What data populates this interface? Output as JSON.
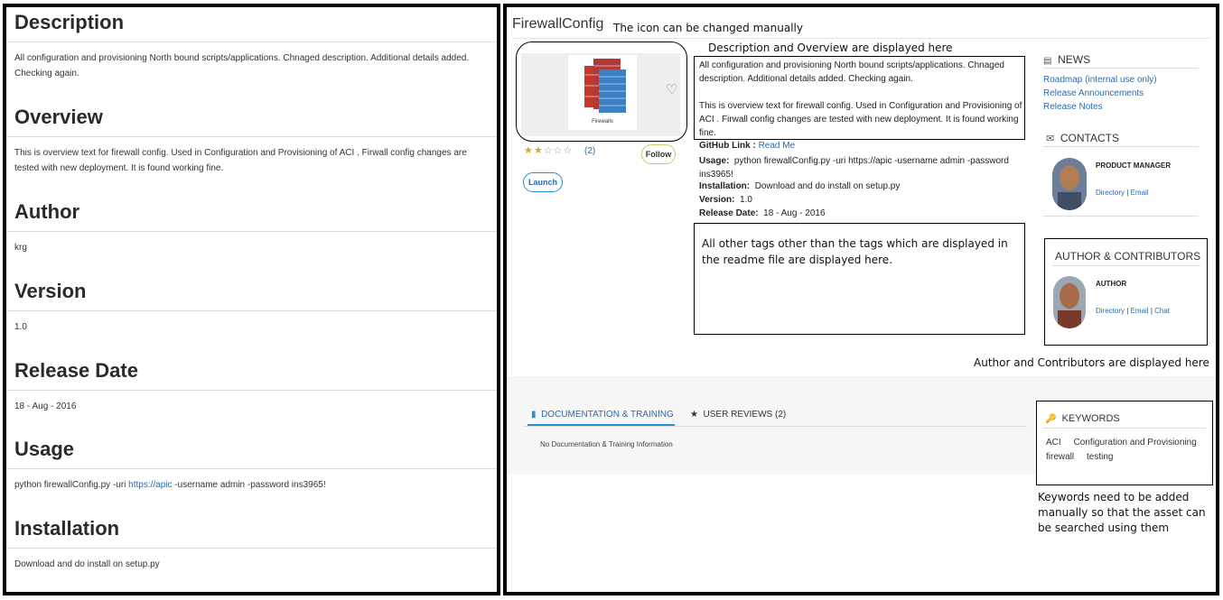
{
  "readme": {
    "sections": [
      {
        "heading": "Description",
        "body": "All configuration and provisioning North bound scripts/applications. Chnaged description. Additional details added. Checking again."
      },
      {
        "heading": "Overview",
        "body": "This is overview text for firewall config. Used in Configuration and Provisioning of ACI . Firwall config changes are tested with new deployment. It is found working fine."
      },
      {
        "heading": "Author",
        "body": "krg"
      },
      {
        "heading": "Version",
        "body": "1.0"
      },
      {
        "heading": "Release Date",
        "body": "18 - Aug - 2016"
      },
      {
        "heading": "Usage",
        "body_before": "python firewallConfig.py -uri ",
        "body_link": "https://apic",
        "body_after": " -username admin -password ins3965!"
      },
      {
        "heading": "Installation",
        "body": "Download and do install on setup.py"
      }
    ]
  },
  "asset": {
    "title": "FirewallConfig",
    "icon_note": "The icon can be changed manually",
    "icon": {
      "name": "firewall-icon",
      "caption": "Firewalls",
      "colors": {
        "brick_red": "#c0392b",
        "brick_blue": "#3b7fc4"
      }
    },
    "rating": {
      "value": 2,
      "max": 5,
      "count": "(2)"
    },
    "follow_label": "Follow",
    "launch_label": "Launch",
    "desc_note": "Description and Overview are displayed here",
    "description": "All configuration and provisioning North bound scripts/applications. Chnaged description. Additional details added. Checking again.",
    "overview": "This is overview text for firewall config. Used in Configuration and Provisioning of ACI . Firwall config changes are tested with new deployment. It is found working fine.",
    "github_label": "GitHub Link :",
    "github_link": "Read Me",
    "usage_label": "Usage:",
    "usage": "python firewallConfig.py -uri https://apic -username admin -password ins3965!",
    "installation_label": "Installation:",
    "installation": "Download and do install on setup.py",
    "version_label": "Version:",
    "version": "1.0",
    "release_label": "Release Date:",
    "release_date": "18 - Aug - 2016",
    "tags_note": "All other tags other than the tags which are displayed in the readme file are displayed here."
  },
  "sidebar": {
    "news": {
      "title": "NEWS",
      "links": [
        "Roadmap (internal use only)",
        "Release Announcements",
        "Release Notes"
      ]
    },
    "contacts": {
      "title": "CONTACTS",
      "role": "PRODUCT MANAGER",
      "links": [
        "Directory",
        "Email"
      ]
    },
    "authors": {
      "title": "AUTHOR & CONTRIBUTORS",
      "role": "AUTHOR",
      "links": [
        "Directory",
        "Email",
        "Chat"
      ]
    },
    "authors_note": "Author and Contributors are displayed here"
  },
  "tabs": {
    "docs_label": "DOCUMENTATION & TRAINING",
    "reviews_label": "USER REVIEWS (2)",
    "no_docs": "No Documentation & Training Information"
  },
  "keywords": {
    "title": "KEYWORDS",
    "items": [
      "ACI",
      "Configuration and Provisioning",
      "firewall",
      "testing"
    ],
    "note": "Keywords need to be added manually so that the asset can be searched using them"
  },
  "colors": {
    "link": "#2a6bb0",
    "accent": "#2a8fd0",
    "star": "#e0a030"
  }
}
